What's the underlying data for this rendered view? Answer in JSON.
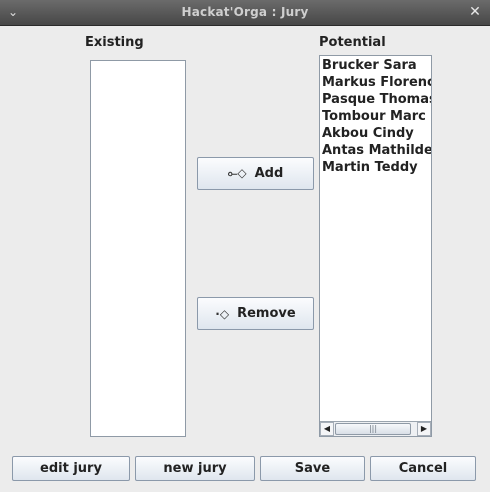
{
  "window": {
    "title": "Hackat'Orga : Jury",
    "menu_glyph": "⌄",
    "close_glyph": "✕"
  },
  "labels": {
    "existing": "Existing",
    "potential": "Potential"
  },
  "existing_list": [],
  "potential_list": [
    "Brucker Sara",
    "Markus Florence",
    "Pasque Thomas",
    "Tombour Marc",
    "Akbou Cindy",
    "Antas Mathilde",
    "Martin Teddy"
  ],
  "buttons": {
    "add": "Add",
    "add_icon": "⟜◇",
    "remove": "Remove",
    "remove_icon": "·◇",
    "edit_jury": "edit jury",
    "new_jury": "new jury",
    "save": "Save",
    "cancel": "Cancel"
  },
  "scrollbar": {
    "left_arrow": "◀",
    "right_arrow": "▶",
    "thumb_grip": "|||"
  }
}
